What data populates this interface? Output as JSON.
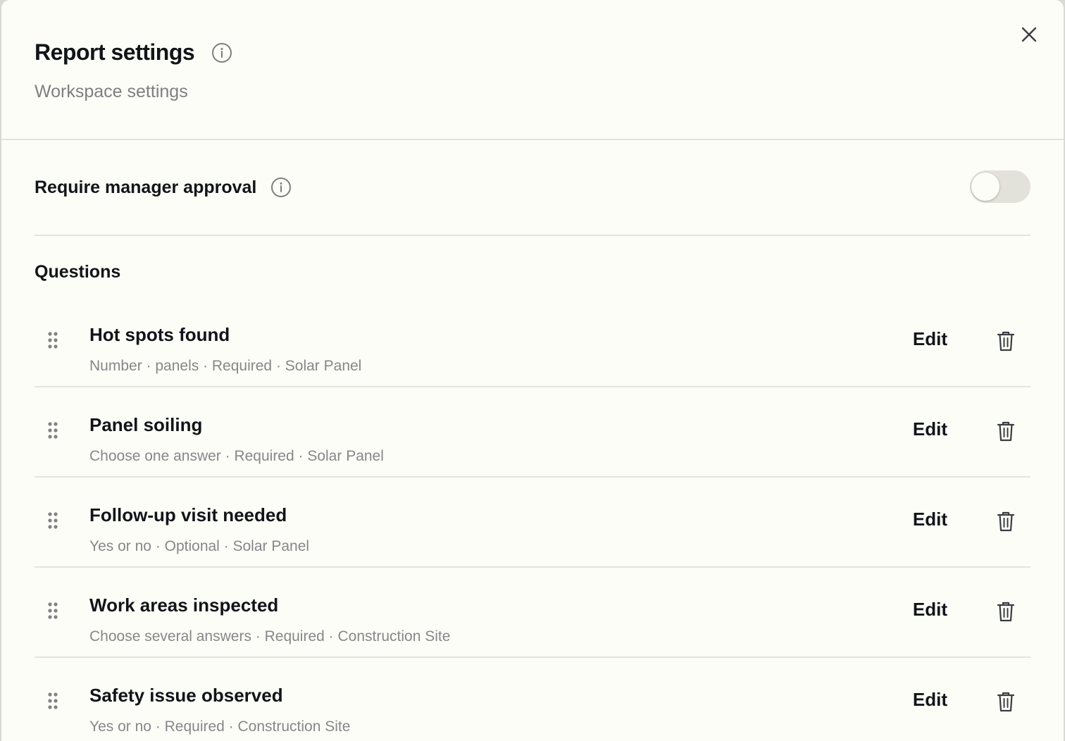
{
  "dialog": {
    "title": "Report settings",
    "subtitle": "Workspace settings"
  },
  "approval": {
    "label": "Require manager approval",
    "enabled": false
  },
  "questions_heading": "Questions",
  "edit_label": "Edit",
  "questions": [
    {
      "title": "Hot spots found",
      "meta": "Number · panels · Required · Solar Panel"
    },
    {
      "title": "Panel soiling",
      "meta": "Choose one answer · Required · Solar Panel"
    },
    {
      "title": "Follow-up visit needed",
      "meta": "Yes or no · Optional · Solar Panel"
    },
    {
      "title": "Work areas inspected",
      "meta": "Choose several answers · Required · Construction Site"
    },
    {
      "title": "Safety issue observed",
      "meta": "Yes or no · Required · Construction Site"
    }
  ],
  "icons": {
    "info": "info-icon",
    "close": "close-icon",
    "drag": "drag-handle-icon",
    "trash": "trash-icon"
  },
  "colors": {
    "background": "#fdfdf7",
    "text": "#111418",
    "muted": "#7d7f82",
    "divider": "#e4e4df",
    "toggle_off": "#e2e1da"
  }
}
